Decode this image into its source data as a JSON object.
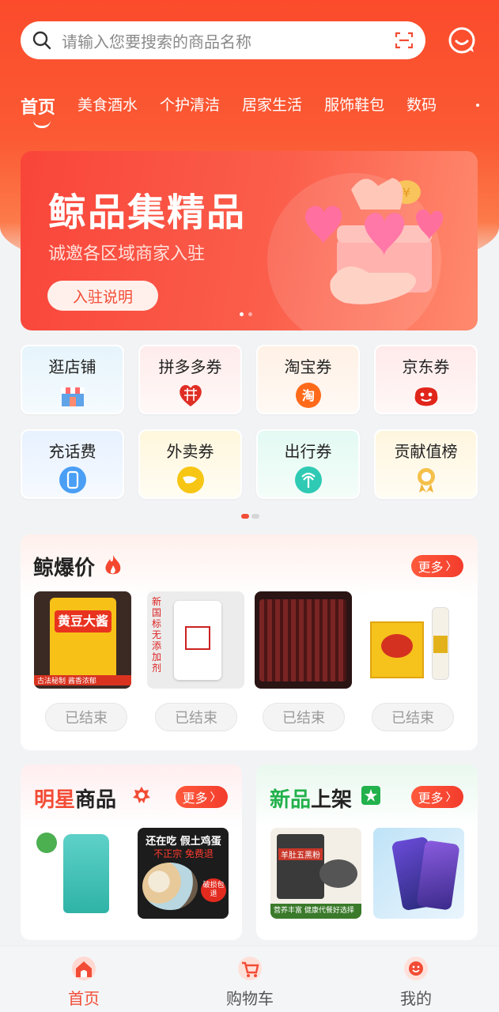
{
  "search": {
    "placeholder": "请输入您要搜索的商品名称"
  },
  "tabs": [
    "首页",
    "美食酒水",
    "个护清洁",
    "居家生活",
    "服饰鞋包",
    "数码"
  ],
  "banner": {
    "title": "鲸品集精品",
    "subtitle": "诚邀各区域商家入驻",
    "button": "入驻说明"
  },
  "shortcuts": [
    {
      "label": "逛店铺",
      "icon": "shop-icon"
    },
    {
      "label": "拼多多券",
      "icon": "pinduoduo-icon"
    },
    {
      "label": "淘宝券",
      "icon": "taobao-icon"
    },
    {
      "label": "京东券",
      "icon": "jd-icon"
    },
    {
      "label": "充话费",
      "icon": "phone-icon"
    },
    {
      "label": "外卖券",
      "icon": "takeout-icon"
    },
    {
      "label": "出行券",
      "icon": "travel-icon"
    },
    {
      "label": "贡献值榜",
      "icon": "medal-icon"
    }
  ],
  "deals": {
    "title": "鲸爆价",
    "more": "更多",
    "items": [
      {
        "image_text": "黄豆大酱",
        "tag": "古法秘制 酱香浓郁",
        "status": "已结束"
      },
      {
        "image_text": "新国标 无添加剂",
        "status": "已结束"
      },
      {
        "image_text": "",
        "status": "已结束"
      },
      {
        "image_text": "",
        "status": "已结束"
      }
    ]
  },
  "star_products": {
    "title_a": "明星",
    "title_b": "商品",
    "more": "更多",
    "egg_text": "还在吃 假土鸡蛋",
    "egg_sub": "不正宗 免费退",
    "egg_badge": "破损包退"
  },
  "new_products": {
    "title_a": "新品",
    "title_b": "上架",
    "more": "更多",
    "food_text": "羊肚五黑粉",
    "food_sub": "营养丰富 健康代餐好选择"
  },
  "bottom_nav": [
    {
      "label": "首页",
      "icon": "home-icon"
    },
    {
      "label": "购物车",
      "icon": "cart-icon"
    },
    {
      "label": "我的",
      "icon": "profile-icon"
    }
  ],
  "colors": {
    "brand": "#f24c36",
    "hero": "#fb5a34"
  }
}
